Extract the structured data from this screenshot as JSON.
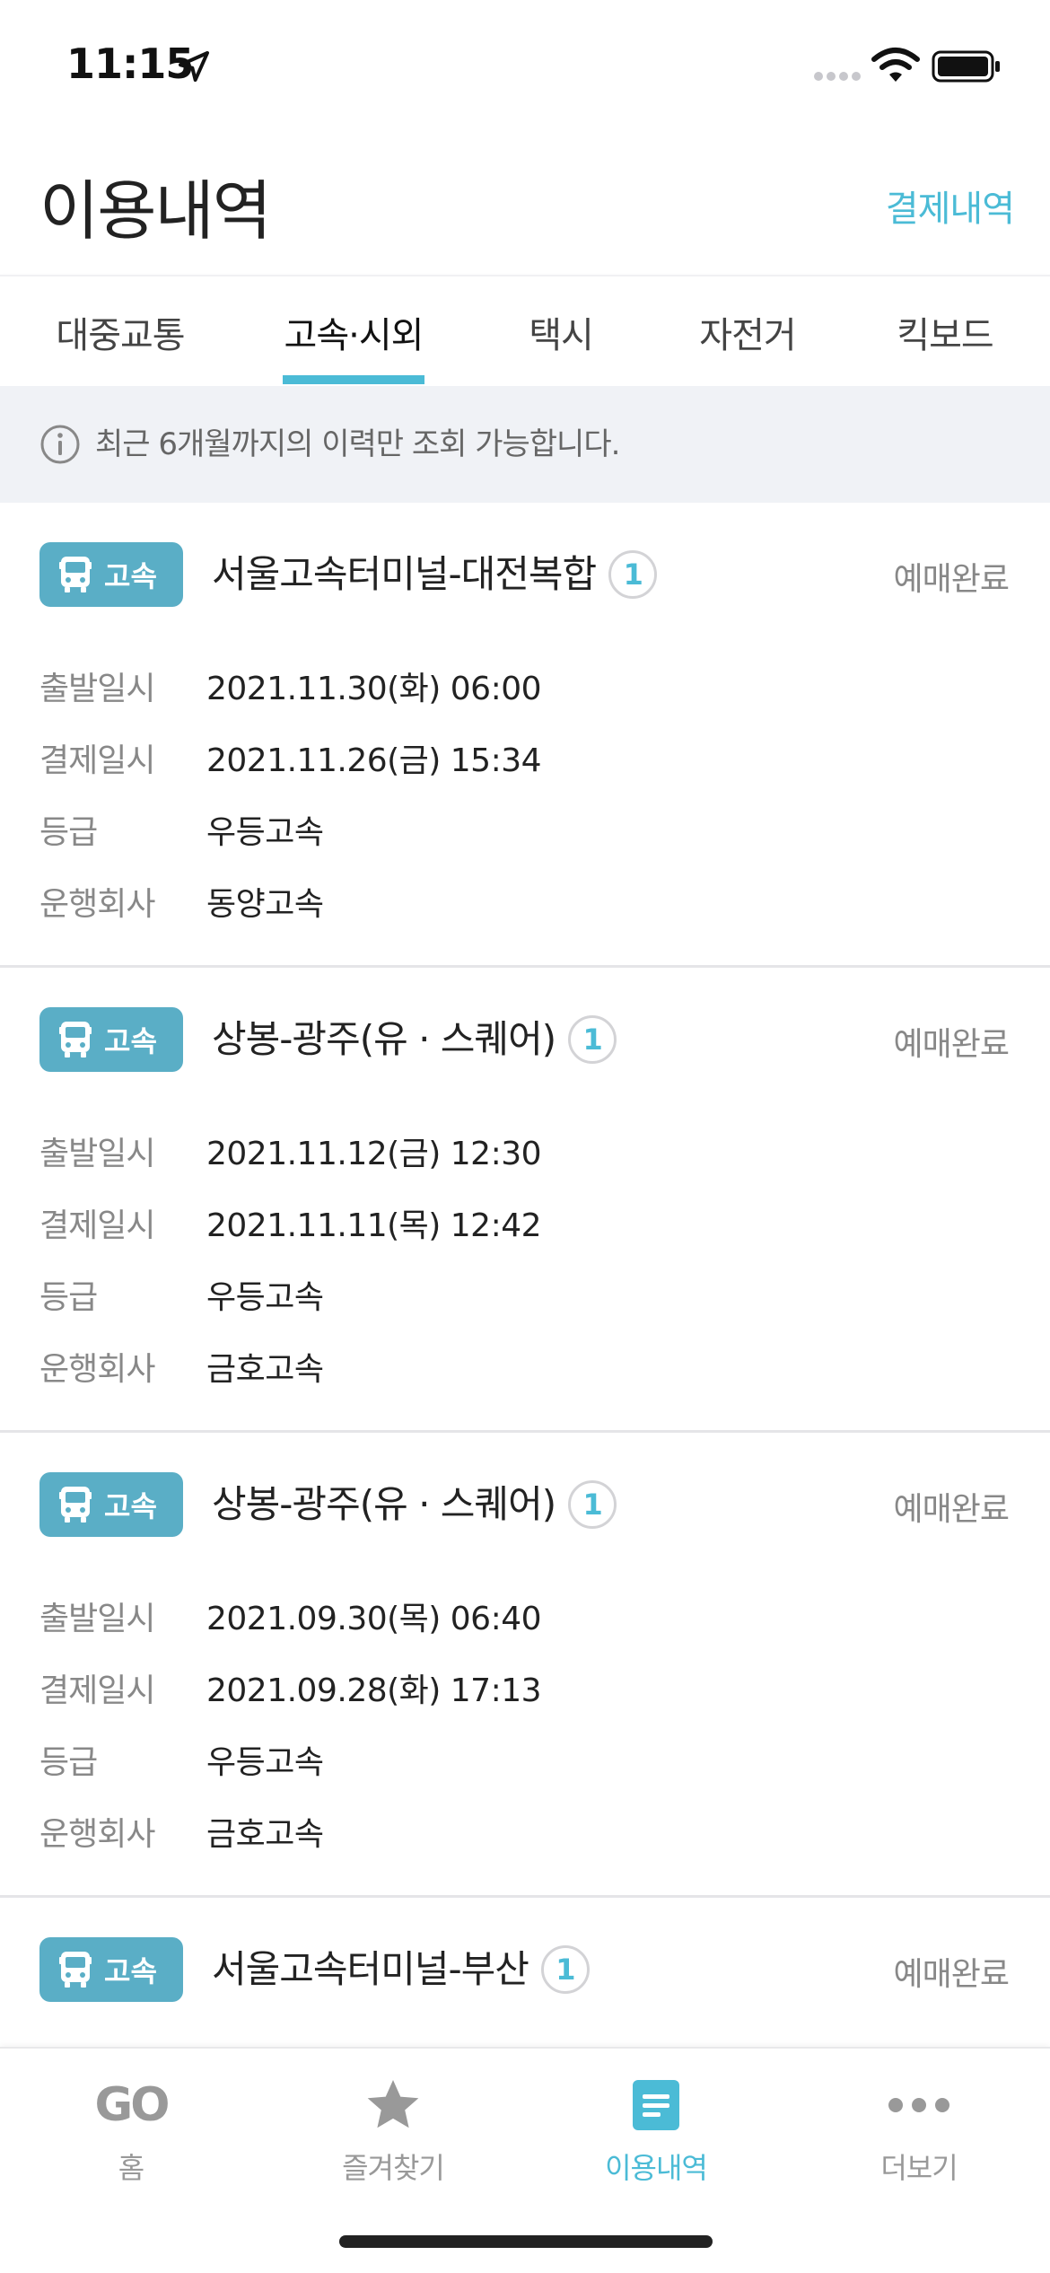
{
  "status_bar": {
    "time": "11:15"
  },
  "header": {
    "title": "이용내역",
    "payment_history_link": "결제내역"
  },
  "tabs": [
    {
      "label": "대중교통",
      "active": false
    },
    {
      "label": "고속·시외",
      "active": true
    },
    {
      "label": "택시",
      "active": false
    },
    {
      "label": "자전거",
      "active": false
    },
    {
      "label": "킥보드",
      "active": false
    }
  ],
  "notice": {
    "text": "최근 6개월까지의 이력만 조회 가능합니다."
  },
  "field_labels": {
    "departure": "출발일시",
    "payment": "결제일시",
    "grade": "등급",
    "company": "운행회사"
  },
  "cards": [
    {
      "badge": "고속",
      "route": "서울고속터미널-대전복합",
      "count": "1",
      "status": "예매완료",
      "departure": "2021.11.30(화) 06:00",
      "payment": "2021.11.26(금) 15:34",
      "grade": "우등고속",
      "company": "동양고속"
    },
    {
      "badge": "고속",
      "route": "상봉-광주(유 · 스퀘어)",
      "count": "1",
      "status": "예매완료",
      "departure": "2021.11.12(금) 12:30",
      "payment": "2021.11.11(목) 12:42",
      "grade": "우등고속",
      "company": "금호고속"
    },
    {
      "badge": "고속",
      "route": "상봉-광주(유 · 스퀘어)",
      "count": "1",
      "status": "예매완료",
      "departure": "2021.09.30(목) 06:40",
      "payment": "2021.09.28(화) 17:13",
      "grade": "우등고속",
      "company": "금호고속"
    },
    {
      "badge": "고속",
      "route": "서울고속터미널-부산",
      "count": "1",
      "status": "예매완료"
    }
  ],
  "bottom_nav": [
    {
      "label": "홈",
      "icon": "go-logo",
      "logo_text": "GO",
      "active": false
    },
    {
      "label": "즐겨찾기",
      "icon": "star-icon",
      "active": false
    },
    {
      "label": "이용내역",
      "icon": "list-document-icon",
      "active": true
    },
    {
      "label": "더보기",
      "icon": "more-dots-icon",
      "active": false
    }
  ],
  "colors": {
    "accent": "#4bbbd6",
    "badge": "#5aaec6",
    "notice_bg": "#f0f2f6"
  }
}
